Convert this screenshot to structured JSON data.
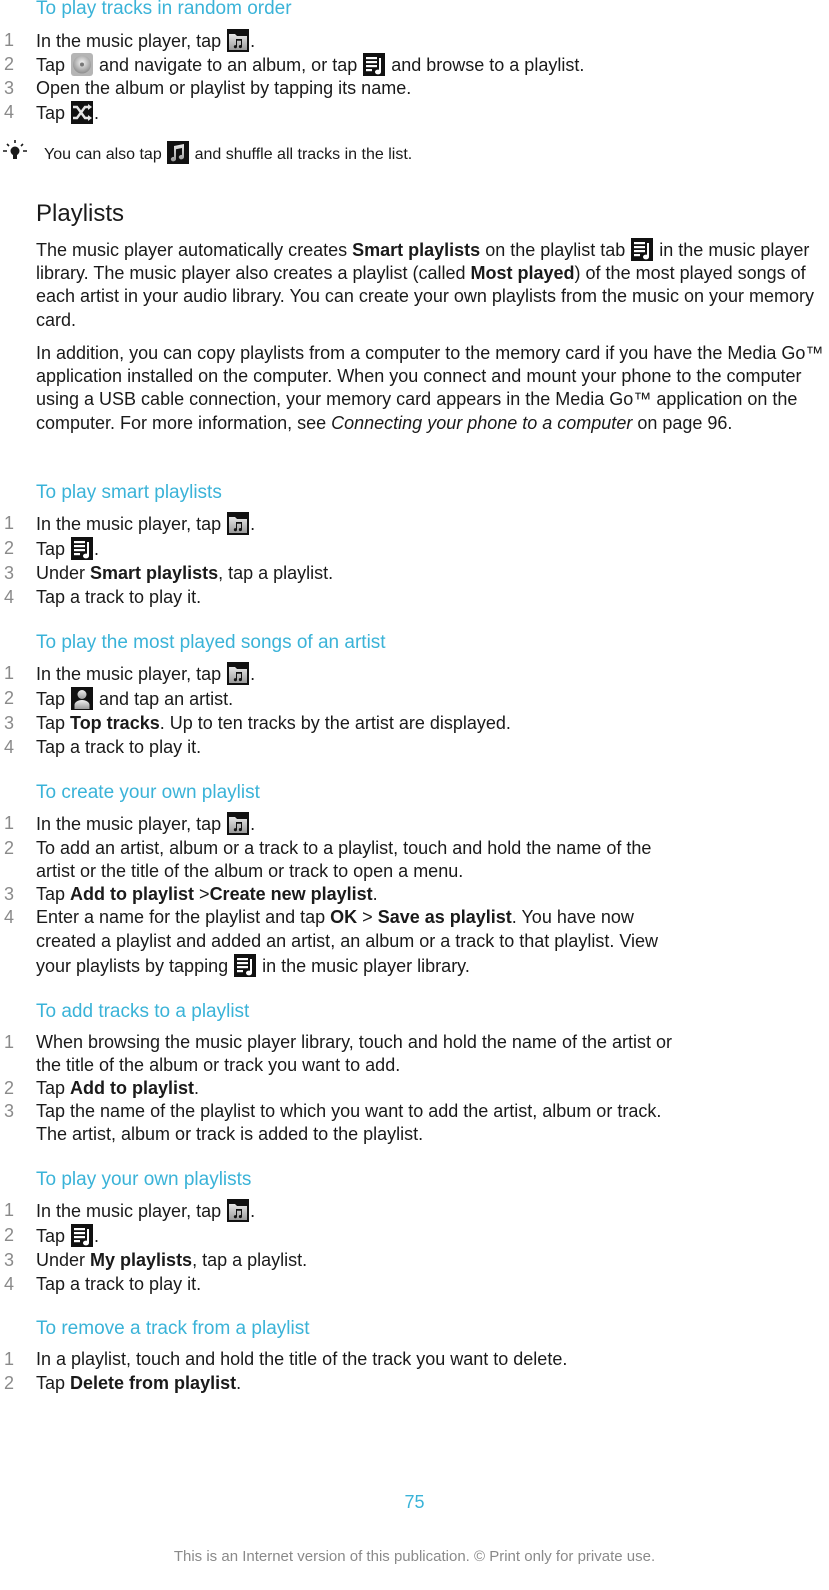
{
  "sections": {
    "random": {
      "title": "To play tracks in random order",
      "steps": [
        {
          "num": "1",
          "a": "In the music player, tap ",
          "b": "."
        },
        {
          "num": "2",
          "a": "Tap ",
          "b": " and navigate to an album, or tap ",
          "c": " and browse to a playlist."
        },
        {
          "num": "3",
          "a": "Open the album or playlist by tapping its name."
        },
        {
          "num": "4",
          "a": "Tap ",
          "b": "."
        }
      ],
      "tip": {
        "a": "You can also tap ",
        "b": " and shuffle all tracks in the list."
      }
    },
    "playlists": {
      "title": "Playlists",
      "p1": {
        "a": "The music player automatically creates ",
        "b_bold": "Smart playlists",
        "c": " on the playlist tab ",
        "d": " in the music player library. The music player also creates a playlist (called ",
        "e_bold": "Most played",
        "f": ") of the most played songs of each artist in your audio library. You can create your own playlists from the music on your memory card."
      },
      "p2": {
        "a": "In addition, you can copy playlists from a computer to the memory card if you have the Media Go™ application installed on the computer. When you connect and mount your phone to the computer using a USB cable connection, your memory card appears in the Media Go™ application on the computer. For more information, see ",
        "b_italic": "Connecting your phone to a computer",
        "c": " on page 96."
      }
    },
    "smart": {
      "title": "To play smart playlists",
      "steps": [
        {
          "num": "1",
          "a": "In the music player, tap ",
          "b": "."
        },
        {
          "num": "2",
          "a": "Tap ",
          "b": "."
        },
        {
          "num": "3",
          "a": "Under ",
          "bold": "Smart playlists",
          "b": ", tap a playlist."
        },
        {
          "num": "4",
          "a": "Tap a track to play it."
        }
      ]
    },
    "mostplayed": {
      "title": "To play the most played songs of an artist",
      "steps": [
        {
          "num": "1",
          "a": "In the music player, tap ",
          "b": "."
        },
        {
          "num": "2",
          "a": "Tap ",
          "b": " and tap an artist."
        },
        {
          "num": "3",
          "a": "Tap ",
          "bold": "Top tracks",
          "b": ". Up to ten tracks by the artist are displayed."
        },
        {
          "num": "4",
          "a": "Tap a track to play it."
        }
      ]
    },
    "create": {
      "title": "To create your own playlist",
      "steps": [
        {
          "num": "1",
          "a": "In the music player, tap ",
          "b": "."
        },
        {
          "num": "2",
          "a": "To add an artist, album or a track to a playlist, touch and hold the name of the",
          "a2": "artist or the title of the album or track to open a menu."
        },
        {
          "num": "3",
          "a": "Tap ",
          "bold": "Add to playlist",
          "b": " >",
          "bold2": "Create new playlist",
          "c": "."
        },
        {
          "num": "4",
          "a": "Enter a name for the playlist and tap ",
          "bold": "OK",
          "b": " > ",
          "bold2": "Save as playlist",
          "c": ". You have now",
          "line2": "created a playlist and added an artist, an album or a track to that playlist. View",
          "line3a": "your playlists by tapping ",
          "line3b": " in the music player library."
        }
      ]
    },
    "addtracks": {
      "title": "To add tracks to a playlist",
      "steps": [
        {
          "num": "1",
          "a": "When browsing the music player library, touch and hold the name of the artist or",
          "a2": "the title of the album or track you want to add."
        },
        {
          "num": "2",
          "a": "Tap ",
          "bold": "Add to playlist",
          "b": "."
        },
        {
          "num": "3",
          "a": "Tap the name of the playlist to which you want to add the artist, album or track.",
          "a2": "The artist, album or track is added to the playlist."
        }
      ]
    },
    "own": {
      "title": "To play your own playlists",
      "steps": [
        {
          "num": "1",
          "a": "In the music player, tap ",
          "b": "."
        },
        {
          "num": "2",
          "a": "Tap ",
          "b": "."
        },
        {
          "num": "3",
          "a": "Under ",
          "bold": "My playlists",
          "b": ", tap a playlist."
        },
        {
          "num": "4",
          "a": "Tap a track to play it."
        }
      ]
    },
    "remove": {
      "title": "To remove a track from a playlist",
      "steps": [
        {
          "num": "1",
          "a": "In a playlist, touch and hold the title of the track you want to delete."
        },
        {
          "num": "2",
          "a": "Tap ",
          "bold": "Delete from playlist",
          "b": "."
        }
      ]
    }
  },
  "icons": {
    "music_library": "music-folder-icon",
    "album": "album-disc-icon",
    "playlist": "playlist-icon",
    "shuffle": "shuffle-icon",
    "music_note": "music-note-icon",
    "artist": "artist-icon",
    "tip": "lightbulb-tip-icon"
  },
  "colors": {
    "heading": "#3ab3d8",
    "step_number": "#8a8a8a",
    "text": "#1a1a1a"
  },
  "footer": {
    "page_number": "75",
    "note": "This is an Internet version of this publication. © Print only for private use."
  }
}
